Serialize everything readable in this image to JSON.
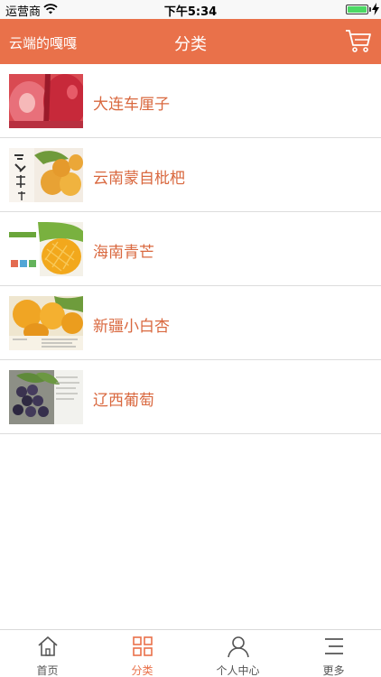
{
  "status": {
    "carrier": "运营商",
    "time": "下午5:34",
    "battery_level": 1.0
  },
  "header": {
    "shop_name": "云端的嘎嘎",
    "title": "分类",
    "cart_icon": "cart-icon"
  },
  "categories": [
    {
      "label": "大连车厘子",
      "image": "cherry-photo"
    },
    {
      "label": "云南蒙自枇杷",
      "image": "loquat-photo"
    },
    {
      "label": "海南青芒",
      "image": "mango-photo"
    },
    {
      "label": "新疆小白杏",
      "image": "apricot-photo"
    },
    {
      "label": "辽西葡萄",
      "image": "grape-photo"
    }
  ],
  "tabs": [
    {
      "label": "首页",
      "icon": "home-icon",
      "active": false
    },
    {
      "label": "分类",
      "icon": "grid-icon",
      "active": true
    },
    {
      "label": "个人中心",
      "icon": "person-icon",
      "active": false
    },
    {
      "label": "更多",
      "icon": "menu-icon",
      "active": false
    }
  ],
  "colors": {
    "accent": "#e9714a",
    "category_text": "#d9683f",
    "divider": "#dcdcdc"
  }
}
